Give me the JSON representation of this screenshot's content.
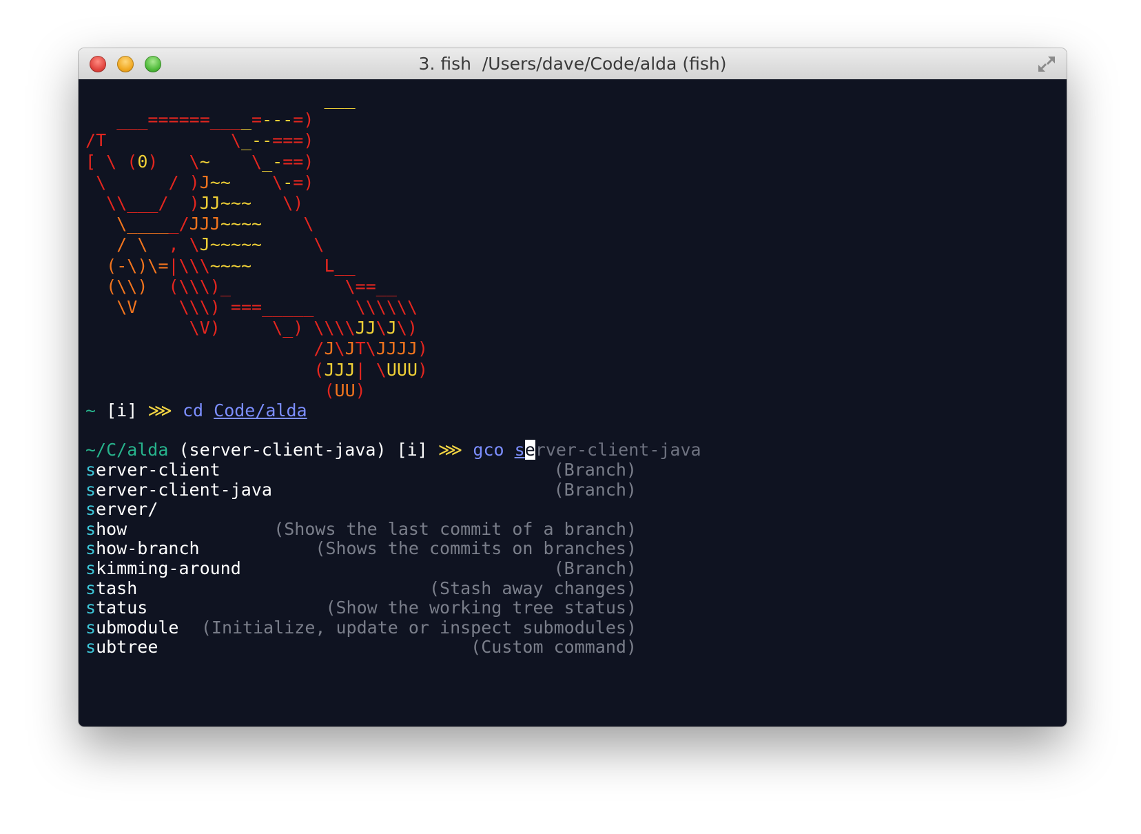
{
  "window": {
    "title": "3. fish  /Users/dave/Code/alda (fish)"
  },
  "ascii_art_lines": [
    "                       ___",
    "   ___======____=---=)",
    "/T            \\_--===)",
    "[ \\ (0)   \\~    \\_-==)",
    " \\      / )J~~    \\-=)",
    "  \\\\___/  )JJ~~~   \\)",
    "   \\_____/JJJ~~~~    \\",
    "   / \\  , \\J~~~~~     \\",
    "  (-\\)\\=|\\\\\\~~~~       L__",
    "  (\\\\)  (\\\\\\)_           \\==__",
    "   \\V    \\\\\\) ===_____    \\\\\\\\\\\\",
    "          \\V)     \\_) \\\\\\\\JJ\\J\\)",
    "                      /J\\JT\\JJJJ)",
    "                      (JJJ| \\UUU)",
    "                       (UU)"
  ],
  "prompt1": {
    "tilde": "~",
    "indicator": "[i]",
    "arrow": "⋙",
    "command": "cd",
    "argument": "Code/alda"
  },
  "prompt2": {
    "cwd": "~/C/alda",
    "branch": "(server-client-java)",
    "indicator": "[i]",
    "arrow": "⋙",
    "command": "gco",
    "typed": "s",
    "cursor_char": "e",
    "suggestion": "rver-client-java"
  },
  "completions": [
    {
      "prefix": "s",
      "rest": "erver-client",
      "description": "(Branch)"
    },
    {
      "prefix": "s",
      "rest": "erver-client-java",
      "description": "(Branch)"
    },
    {
      "prefix": "s",
      "rest": "erver/",
      "description": ""
    },
    {
      "prefix": "s",
      "rest": "how",
      "description": "(Shows the last commit of a branch)"
    },
    {
      "prefix": "s",
      "rest": "how-branch",
      "description": "(Shows the commits on branches)"
    },
    {
      "prefix": "s",
      "rest": "kimming-around",
      "description": "(Branch)"
    },
    {
      "prefix": "s",
      "rest": "tash",
      "description": "(Stash away changes)"
    },
    {
      "prefix": "s",
      "rest": "tatus",
      "description": "(Show the working tree status)"
    },
    {
      "prefix": "s",
      "rest": "ubmodule",
      "description": "(Initialize, update or inspect submodules)"
    },
    {
      "prefix": "s",
      "rest": "ubtree",
      "description": "(Custom command)"
    }
  ],
  "colors": {
    "terminal_bg": "#0f1321",
    "ascii_red": "#e3261f",
    "ascii_orange": "#f1741e",
    "ascii_yellow": "#f0d036",
    "prompt_green": "#27b38c",
    "command_blue": "#7c8eff",
    "completion_prefix": "#3ec6d8"
  }
}
